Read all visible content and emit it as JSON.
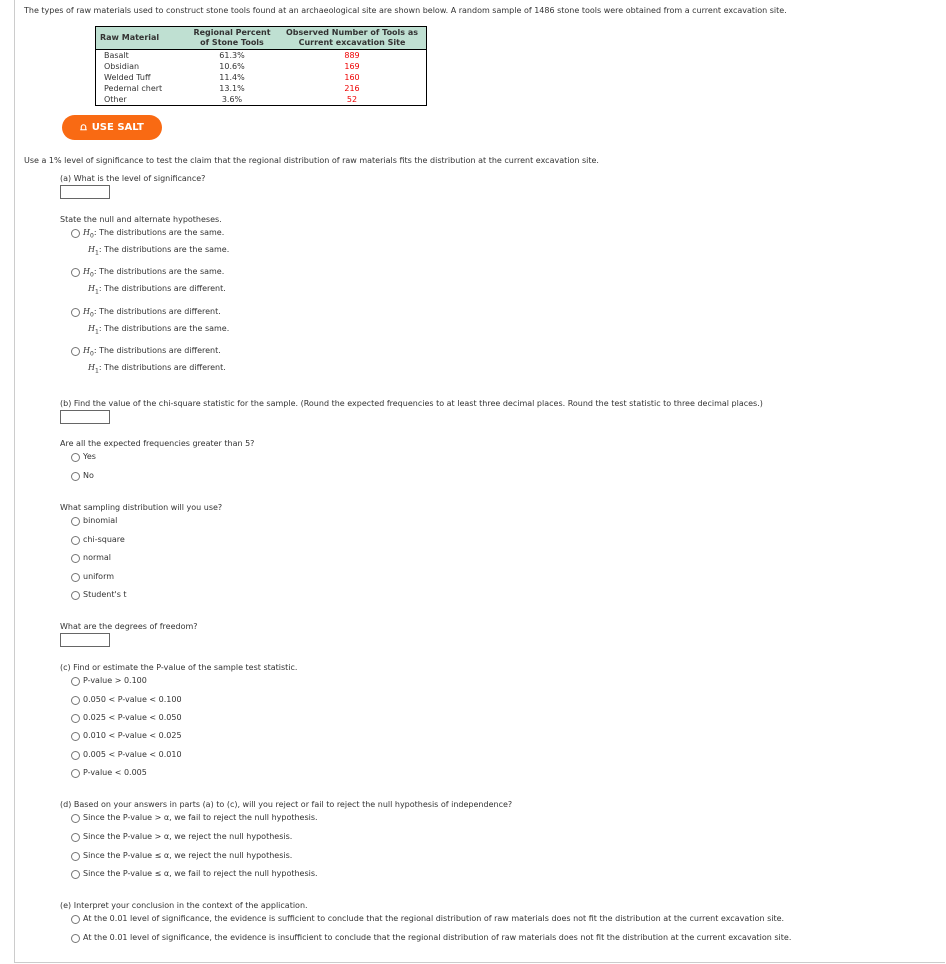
{
  "intro": "The types of raw materials used to construct stone tools found at an archaeological site are shown below. A random sample of 1486 stone tools were obtained from a current excavation site.",
  "table": {
    "headers": [
      "Raw Material",
      "Regional Percent of Stone Tools",
      "Observed Number of Tools as Current excavation Site"
    ],
    "rows": [
      [
        "Basalt",
        "61.3%",
        "889"
      ],
      [
        "Obsidian",
        "10.6%",
        "169"
      ],
      [
        "Welded Tuff",
        "11.4%",
        "160"
      ],
      [
        "Pedernal chert",
        "13.1%",
        "216"
      ],
      [
        "Other",
        "3.6%",
        "52"
      ]
    ]
  },
  "salt_label": "USE SALT",
  "claim": "Use a 1% level of significance to test the claim that the regional distribution of raw materials fits the distribution at the current excavation site.",
  "a": "(a) What is the level of significance?",
  "hyp_prompt": "State the null and alternate hypotheses.",
  "hyps": [
    [
      "The distributions are the same.",
      "The distributions are the same."
    ],
    [
      "The distributions are the same.",
      "The distributions are different."
    ],
    [
      "The distributions are different.",
      "The distributions are the same."
    ],
    [
      "The distributions are different.",
      "The distributions are different."
    ]
  ],
  "b": "(b) Find the value of the chi-square statistic for the sample. (Round the expected frequencies to at least three decimal places. Round the test statistic to three decimal places.)",
  "expected_q": "Are all the expected frequencies greater than 5?",
  "yesno": [
    "Yes",
    "No"
  ],
  "dist_q": "What sampling distribution will you use?",
  "dists": [
    "binomial",
    "chi-square",
    "normal",
    "uniform",
    "Student's t"
  ],
  "df_q": "What are the degrees of freedom?",
  "c": "(c) Find or estimate the P-value of the sample test statistic.",
  "pvals": [
    "P-value > 0.100",
    "0.050 < P-value < 0.100",
    "0.025 < P-value < 0.050",
    "0.010 < P-value < 0.025",
    "0.005 < P-value < 0.010",
    "P-value < 0.005"
  ],
  "d": "(d) Based on your answers in parts (a) to (c), will you reject or fail to reject the null hypothesis of independence?",
  "decisions": [
    "Since the P-value > α, we fail to reject the null hypothesis.",
    "Since the P-value > α, we reject the null hypothesis.",
    "Since the P-value ≤ α, we reject the null hypothesis.",
    "Since the P-value ≤ α, we fail to reject the null hypothesis."
  ],
  "e": "(e) Interpret your conclusion in the context of the application.",
  "conclusions": [
    "At the 0.01 level of significance, the evidence is sufficient to conclude that the regional distribution of raw materials does not fit the distribution at the current excavation site.",
    "At the 0.01 level of significance, the evidence is insufficient to conclude that the regional distribution of raw materials does not fit the distribution at the current excavation site."
  ]
}
